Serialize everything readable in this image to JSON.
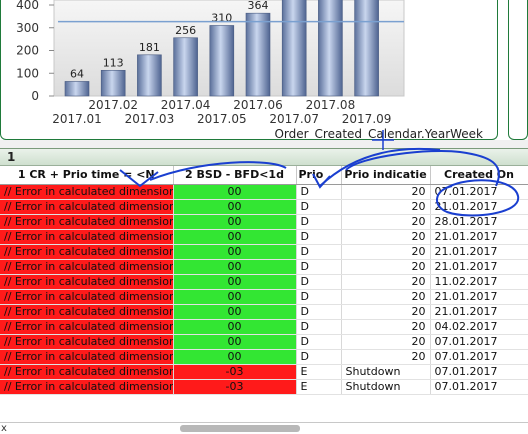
{
  "chart_data": {
    "type": "bar",
    "categories": [
      "2017.01",
      "2017.02",
      "2017.03",
      "2017.04",
      "2017.05",
      "2017.06",
      "2017.07",
      "2017.08",
      "2017.09"
    ],
    "values": [
      64,
      113,
      181,
      256,
      310,
      364,
      430,
      430,
      430
    ],
    "data_labels": [
      "64",
      "113",
      "181",
      "256",
      "310",
      "364",
      "",
      "",
      ""
    ],
    "y_ticks": [
      "0",
      "100",
      "200",
      "300",
      "400"
    ],
    "x_ticks_upper": [
      "2017.02",
      "2017.04",
      "2017.06",
      "2017.08"
    ],
    "x_ticks_lower": [
      "2017.01",
      "2017.03",
      "2017.05",
      "2017.07",
      "2017.09"
    ],
    "xlabel": "Order_Created_Calendar.YearWeek",
    "ylim": [
      0,
      410
    ],
    "reference_line": 327,
    "colors": {
      "bar": "#6f85b0",
      "reference_line": "#7aa0d0"
    }
  },
  "table_panel": {
    "caption": "1",
    "columns": [
      "1 CR + Prio time = <N",
      "2 BSD - BFD<1d",
      "Prio",
      "Prio indicatie",
      "Created On"
    ],
    "rows": [
      {
        "c1": "// Error in calculated dimension",
        "c2": "00",
        "prio": "D",
        "ind": "20",
        "date": "07.01.2017",
        "s": "ok"
      },
      {
        "c1": "// Error in calculated dimension",
        "c2": "00",
        "prio": "D",
        "ind": "20",
        "date": "21.01.2017",
        "s": "ok"
      },
      {
        "c1": "// Error in calculated dimension",
        "c2": "00",
        "prio": "D",
        "ind": "20",
        "date": "28.01.2017",
        "s": "ok"
      },
      {
        "c1": "// Error in calculated dimension",
        "c2": "00",
        "prio": "D",
        "ind": "20",
        "date": "21.01.2017",
        "s": "ok"
      },
      {
        "c1": "// Error in calculated dimension",
        "c2": "00",
        "prio": "D",
        "ind": "20",
        "date": "21.01.2017",
        "s": "ok"
      },
      {
        "c1": "// Error in calculated dimension",
        "c2": "00",
        "prio": "D",
        "ind": "20",
        "date": "21.01.2017",
        "s": "ok"
      },
      {
        "c1": "// Error in calculated dimension",
        "c2": "00",
        "prio": "D",
        "ind": "20",
        "date": "11.02.2017",
        "s": "ok"
      },
      {
        "c1": "// Error in calculated dimension",
        "c2": "00",
        "prio": "D",
        "ind": "20",
        "date": "21.01.2017",
        "s": "ok"
      },
      {
        "c1": "// Error in calculated dimension",
        "c2": "00",
        "prio": "D",
        "ind": "20",
        "date": "21.01.2017",
        "s": "ok"
      },
      {
        "c1": "// Error in calculated dimension",
        "c2": "00",
        "prio": "D",
        "ind": "20",
        "date": "04.02.2017",
        "s": "ok"
      },
      {
        "c1": "// Error in calculated dimension",
        "c2": "00",
        "prio": "D",
        "ind": "20",
        "date": "07.01.2017",
        "s": "ok"
      },
      {
        "c1": "// Error in calculated dimension",
        "c2": "00",
        "prio": "D",
        "ind": "20",
        "date": "07.01.2017",
        "s": "ok"
      },
      {
        "c1": "// Error in calculated dimension",
        "c2": "-03",
        "prio": "E",
        "ind": "Shutdown",
        "date": "07.01.2017",
        "s": "neg"
      },
      {
        "c1": "// Error in calculated dimension",
        "c2": "-03",
        "prio": "E",
        "ind": "Shutdown",
        "date": "07.01.2017",
        "s": "neg"
      }
    ]
  },
  "status_bar": {
    "text": "x"
  },
  "colors": {
    "error_cell": "#ff1a1a",
    "ok_cell": "#33e633",
    "annotation_ink": "#1a3fd0",
    "panel_border": "#1f7a3a"
  }
}
